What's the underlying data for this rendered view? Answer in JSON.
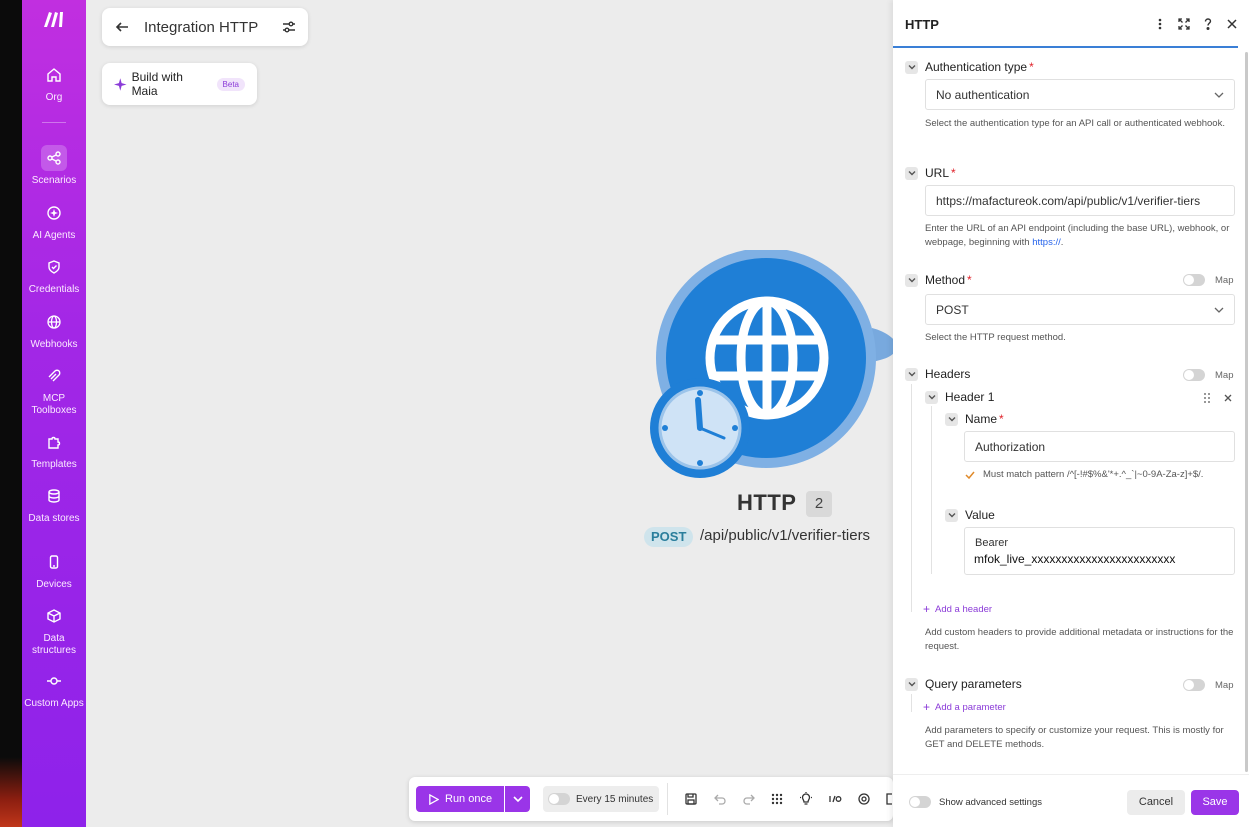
{
  "sidebar": {
    "items": [
      {
        "label": "Org",
        "icon": "home-icon"
      },
      {
        "label": "Scenarios",
        "icon": "share-icon"
      },
      {
        "label": "AI Agents",
        "icon": "ai-agent-icon"
      },
      {
        "label": "Credentials",
        "icon": "shield-icon"
      },
      {
        "label": "Webhooks",
        "icon": "globe-icon"
      },
      {
        "label": "MCP Toolboxes",
        "icon": "mcp-icon"
      },
      {
        "label": "Templates",
        "icon": "puzzle-icon"
      },
      {
        "label": "Data stores",
        "icon": "database-icon"
      },
      {
        "label": "Devices",
        "icon": "device-icon"
      },
      {
        "label": "Data structures",
        "icon": "cube-icon"
      },
      {
        "label": "Custom Apps",
        "icon": "commit-icon"
      }
    ]
  },
  "header": {
    "title": "Integration HTTP"
  },
  "maia": {
    "label": "Build with Maia",
    "badge": "Beta"
  },
  "module": {
    "name": "HTTP",
    "count": "2",
    "method": "POST",
    "path": "/api/public/v1/verifier-tiers"
  },
  "toolbar": {
    "run_label": "Run once",
    "schedule_label": "Every 15 minutes"
  },
  "panel": {
    "title": "HTTP",
    "auth": {
      "label": "Authentication type",
      "value": "No authentication",
      "hint": "Select the authentication type for an API call or authenticated webhook."
    },
    "url": {
      "label": "URL",
      "value": "https://mafactureok.com/api/public/v1/verifier-tiers",
      "hint": "Enter the URL of an API endpoint (including the base URL), webhook, or webpage, beginning with",
      "hint_link": "https://",
      "hint_end": "."
    },
    "method": {
      "label": "Method",
      "value": "POST",
      "hint": "Select the HTTP request method.",
      "map_label": "Map"
    },
    "headers": {
      "label": "Headers",
      "map_label": "Map",
      "item_label": "Header 1",
      "name_label": "Name",
      "name_value": "Authorization",
      "pattern_hint": "Must match pattern /^[-!#$%&'*+.^_`|~0-9A-Za-z]+$/.",
      "value_label": "Value",
      "value_line1": "Bearer",
      "value_line2": "mfok_live_xxxxxxxxxxxxxxxxxxxxxxxx",
      "add_label": "Add a header",
      "hint": "Add custom headers to provide additional metadata or instructions for the request."
    },
    "query": {
      "label": "Query parameters",
      "map_label": "Map",
      "add_label": "Add a parameter",
      "hint": "Add parameters to specify or customize your request. This is mostly for GET and DELETE methods."
    },
    "footer": {
      "advanced_label": "Show advanced settings",
      "cancel_label": "Cancel",
      "save_label": "Save"
    }
  },
  "colors": {
    "accent": "#9a35e8",
    "sidebar_top": "#c12fe0",
    "sidebar_bottom": "#8e22ea",
    "module_blue": "#1f7fd6",
    "link": "#2563eb"
  }
}
